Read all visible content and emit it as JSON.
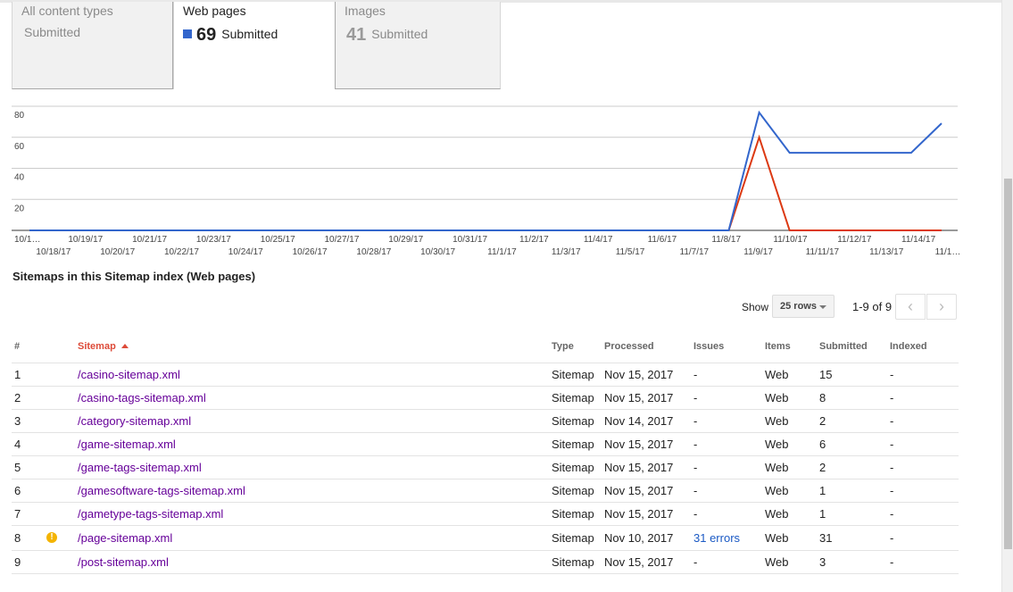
{
  "tabs": [
    {
      "title": "All content types",
      "count": "",
      "sub": "Submitted"
    },
    {
      "title": "Web pages",
      "count": "69",
      "sub": "Submitted"
    },
    {
      "title": "Images",
      "count": "41",
      "sub": "Submitted"
    }
  ],
  "colors": {
    "submitted": "#3366cc",
    "indexed": "#dc3912",
    "accent": "#dd4b39",
    "link": "#1a59c4"
  },
  "chart_data": {
    "type": "line",
    "ylim": [
      0,
      80
    ],
    "y_ticks": [
      "80",
      "60",
      "40",
      "20"
    ],
    "x_tick_labels": [
      "10/1…",
      "10/18/17",
      "10/19/17",
      "10/20/17",
      "10/21/17",
      "10/22/17",
      "10/23/17",
      "10/24/17",
      "10/25/17",
      "10/26/17",
      "10/27/17",
      "10/28/17",
      "10/29/17",
      "10/30/17",
      "10/31/17",
      "11/1/17",
      "11/2/17",
      "11/3/17",
      "11/4/17",
      "11/5/17",
      "11/6/17",
      "11/7/17",
      "11/8/17",
      "11/9/17",
      "11/10/17",
      "11/11/17",
      "11/12/17",
      "11/13/17",
      "11/14/17",
      "11/1…"
    ],
    "grid": true,
    "series": [
      {
        "values": [
          0,
          0,
          0,
          0,
          0,
          0,
          0,
          0,
          0,
          0,
          0,
          0,
          0,
          0,
          0,
          0,
          0,
          0,
          0,
          0,
          0,
          0,
          0,
          0,
          76,
          50,
          50,
          50,
          50,
          50,
          69
        ]
      },
      {
        "values": [
          0,
          0,
          0,
          0,
          0,
          0,
          0,
          0,
          0,
          0,
          0,
          0,
          0,
          0,
          0,
          0,
          0,
          0,
          0,
          0,
          0,
          0,
          0,
          0,
          60,
          0,
          0,
          0,
          0,
          0,
          0
        ]
      }
    ]
  },
  "section_title": "Sitemaps in this Sitemap index (Web pages)",
  "pager": {
    "show_label": "Show",
    "rows_value": "25 rows",
    "range": "1-9 of 9",
    "prev": "‹",
    "next": "›"
  },
  "table": {
    "headers": {
      "num": "#",
      "sitemap": "Sitemap",
      "type": "Type",
      "processed": "Processed",
      "issues": "Issues",
      "items": "Items",
      "submitted": "Submitted",
      "indexed": "Indexed"
    },
    "rows": [
      {
        "num": "1",
        "sitemap": "/casino-sitemap.xml",
        "type": "Sitemap",
        "processed": "Nov 15, 2017",
        "issues": "-",
        "items": "Web",
        "submitted": "15",
        "indexed": "-"
      },
      {
        "num": "2",
        "sitemap": "/casino-tags-sitemap.xml",
        "type": "Sitemap",
        "processed": "Nov 15, 2017",
        "issues": "-",
        "items": "Web",
        "submitted": "8",
        "indexed": "-"
      },
      {
        "num": "3",
        "sitemap": "/category-sitemap.xml",
        "type": "Sitemap",
        "processed": "Nov 14, 2017",
        "issues": "-",
        "items": "Web",
        "submitted": "2",
        "indexed": "-"
      },
      {
        "num": "4",
        "sitemap": "/game-sitemap.xml",
        "type": "Sitemap",
        "processed": "Nov 15, 2017",
        "issues": "-",
        "items": "Web",
        "submitted": "6",
        "indexed": "-"
      },
      {
        "num": "5",
        "sitemap": "/game-tags-sitemap.xml",
        "type": "Sitemap",
        "processed": "Nov 15, 2017",
        "issues": "-",
        "items": "Web",
        "submitted": "2",
        "indexed": "-"
      },
      {
        "num": "6",
        "sitemap": "/gamesoftware-tags-sitemap.xml",
        "type": "Sitemap",
        "processed": "Nov 15, 2017",
        "issues": "-",
        "items": "Web",
        "submitted": "1",
        "indexed": "-"
      },
      {
        "num": "7",
        "sitemap": "/gametype-tags-sitemap.xml",
        "type": "Sitemap",
        "processed": "Nov 15, 2017",
        "issues": "-",
        "items": "Web",
        "submitted": "1",
        "indexed": "-"
      },
      {
        "num": "8",
        "sitemap": "/page-sitemap.xml",
        "type": "Sitemap",
        "processed": "Nov 10, 2017",
        "issues": "31 errors",
        "items": "Web",
        "submitted": "31",
        "indexed": "-",
        "warning_icon": "!"
      },
      {
        "num": "9",
        "sitemap": "/post-sitemap.xml",
        "type": "Sitemap",
        "processed": "Nov 15, 2017",
        "issues": "-",
        "items": "Web",
        "submitted": "3",
        "indexed": "-"
      }
    ]
  },
  "bottom_pager": {
    "range": "1-9 of 9"
  }
}
